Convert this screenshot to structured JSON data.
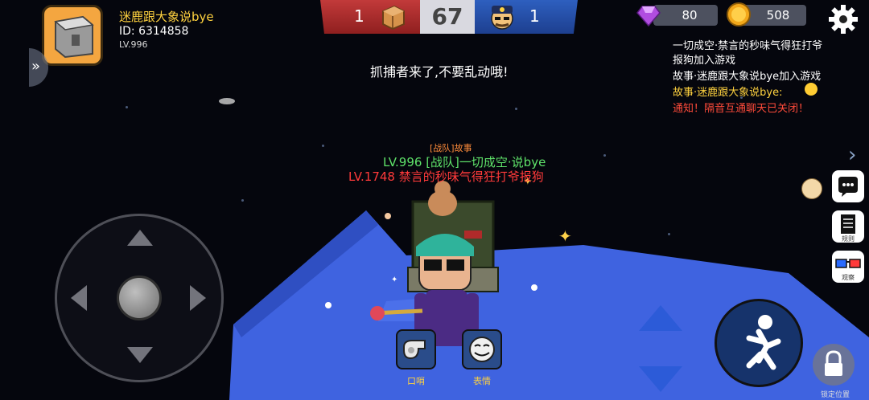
{
  "player": {
    "name": "迷鹿跟大象说bye",
    "id_label": "ID:  6314858",
    "level": "LV.996"
  },
  "scoreboard": {
    "red_score": "1",
    "timer": "67",
    "blue_score": "1"
  },
  "currency": {
    "gems": "80",
    "coins": "508"
  },
  "center_message": "抓捕者来了,不要乱动哦!",
  "chat": [
    {
      "text": "一切成空·禁言的秒味气得狂打爷",
      "color": "#ffffff"
    },
    {
      "text": "报狗加入游戏",
      "color": "#ffffff"
    },
    {
      "text": "故事·迷鹿跟大象说bye加入游戏",
      "color": "#ffffff"
    },
    {
      "text": "故事·迷鹿跟大象说bye:",
      "color": "#ffd23f"
    },
    {
      "text": "通知！隔音互通聊天已关闭！",
      "color": "#ff4b3a"
    }
  ],
  "nameplates": {
    "team_tag": "[战队]故事",
    "line1": "LV.996 [战队]一切成空·说bye",
    "line2": "LV.1748 禁言的秒味气得狂打爷报狗"
  },
  "right_buttons": [
    {
      "icon": "chat-bubble-icon",
      "label": ""
    },
    {
      "icon": "document-icon",
      "label": "规则"
    },
    {
      "icon": "3d-glasses-icon",
      "label": "观察"
    }
  ],
  "items": [
    {
      "icon": "whistle-icon",
      "label": "口哨"
    },
    {
      "icon": "meme-face-icon",
      "label": "表情"
    }
  ],
  "lock_label": "锁定位置",
  "colors": {
    "accent_yellow": "#ffd23f",
    "team_red": "#c23a3a",
    "team_blue": "#2e5fbf",
    "notice_red": "#ff4b3a",
    "floor_blue": "#3f63e0"
  }
}
